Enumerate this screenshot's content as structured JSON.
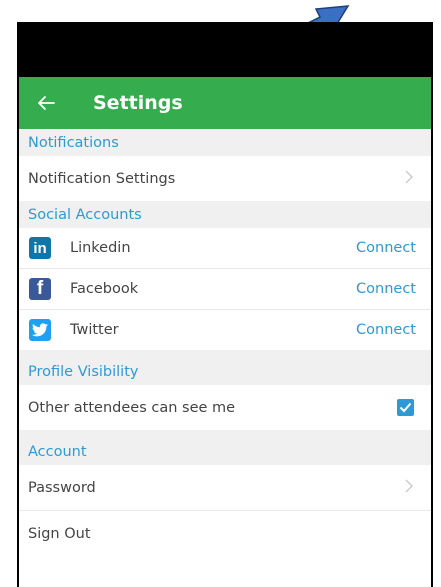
{
  "header": {
    "title": "Settings"
  },
  "sections": {
    "notifications": {
      "title": "Notifications",
      "items": [
        {
          "label": "Notification Settings"
        }
      ]
    },
    "social": {
      "title": "Social Accounts",
      "items": [
        {
          "label": "Linkedin",
          "logo_text": "in",
          "action": "Connect"
        },
        {
          "label": "Facebook",
          "logo_text": "f",
          "action": "Connect"
        },
        {
          "label": "Twitter",
          "action": "Connect"
        }
      ]
    },
    "profile": {
      "title": "Profile Visibility",
      "items": [
        {
          "label": "Other attendees can see me",
          "checked": true
        }
      ]
    },
    "account": {
      "title": "Account",
      "items": [
        {
          "label": "Password"
        },
        {
          "label": "Sign Out"
        }
      ]
    }
  },
  "colors": {
    "app_bar": "#35ad4f",
    "accent": "#2d9ad6",
    "section_bg": "#f0f0f0",
    "annotation_arrow": "#3a6fc4"
  }
}
